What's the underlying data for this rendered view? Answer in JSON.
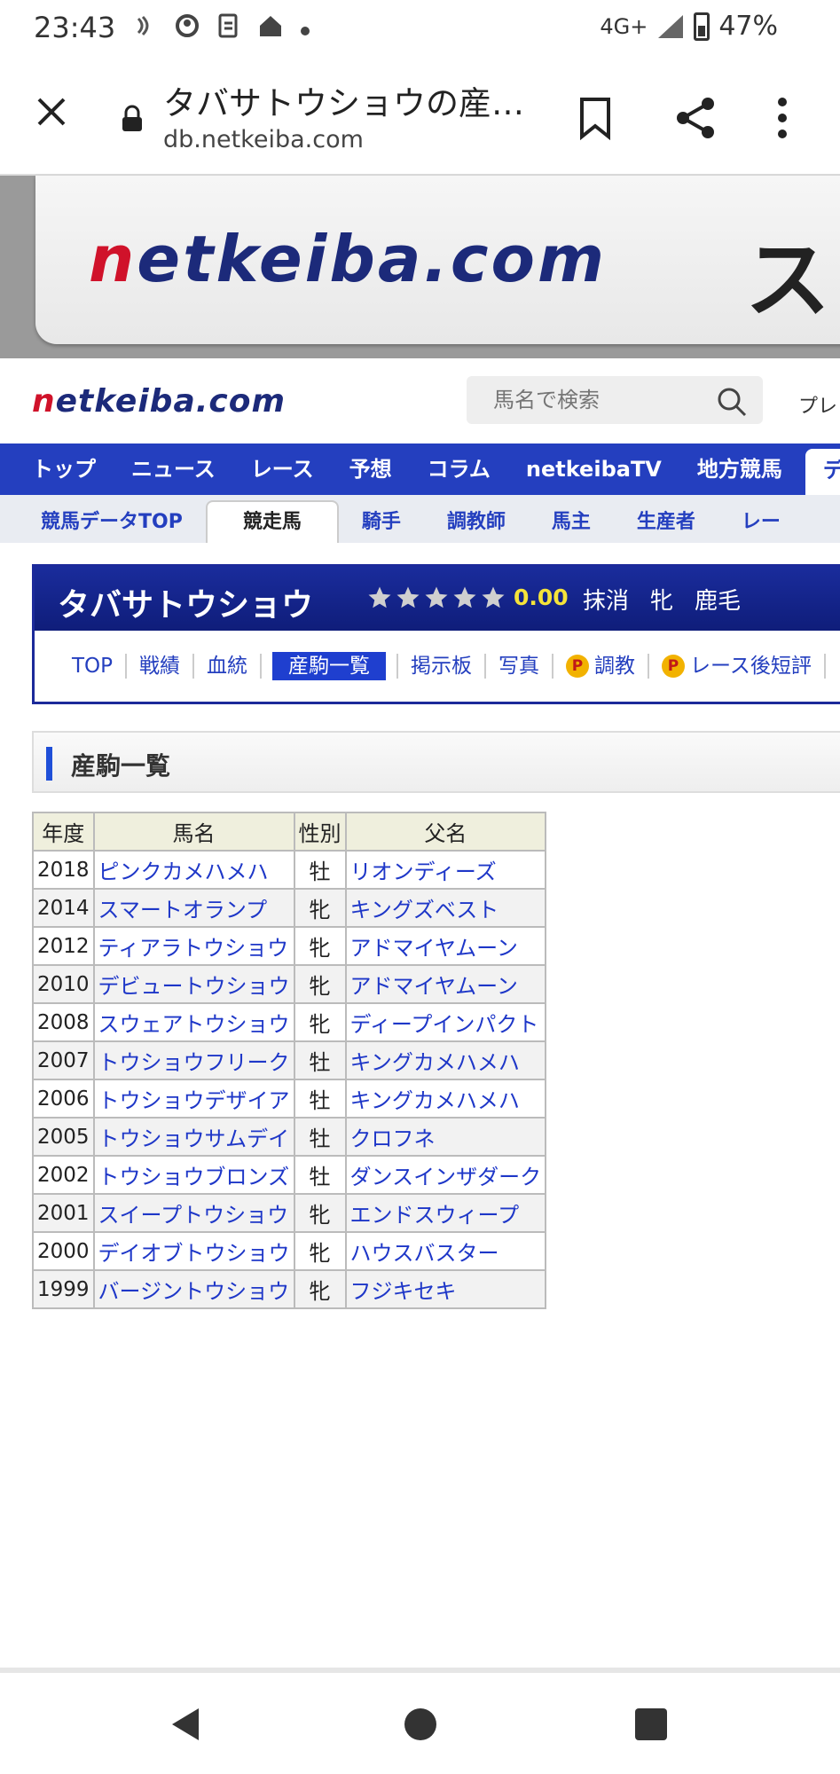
{
  "status_bar": {
    "time": "23:43",
    "network": "4G+",
    "battery": "47%",
    "icons": [
      "nfc-icon",
      "account-sync-icon",
      "file-transfer-icon",
      "home-icon",
      "dot-icon",
      "signal-icon",
      "battery-icon"
    ]
  },
  "browser": {
    "title": "タバサトウショウの産…",
    "url": "db.netkeiba.com",
    "icons": [
      "close-icon",
      "lock-icon",
      "bookmark-icon",
      "share-icon",
      "more-vert-icon"
    ]
  },
  "banner": {
    "logo_text": "netkeiba.com",
    "extra_text": "ス"
  },
  "header": {
    "logo_text": "netkeiba.com",
    "search_placeholder": "馬名で検索",
    "premium_label": "プレ"
  },
  "main_nav": [
    "トップ",
    "ニュース",
    "レース",
    "予想",
    "コラム",
    "netkeibaTV",
    "地方競馬",
    "デー"
  ],
  "sub_nav": [
    "競馬データTOP",
    "競走馬",
    "騎手",
    "調教師",
    "馬主",
    "生産者",
    "レー"
  ],
  "horse": {
    "name": "タバサトウショウ",
    "stars": 5,
    "rating": "0.00",
    "status": "抹消",
    "sex": "牝",
    "color": "鹿毛",
    "tabs": [
      "TOP",
      "戦績",
      "血統",
      "産駒一覧",
      "掲示板",
      "写真",
      "調教",
      "レース後短評"
    ],
    "badge_label": "P"
  },
  "section": {
    "title": "産駒一覧"
  },
  "table": {
    "headers": [
      "年度",
      "馬名",
      "性別",
      "父名"
    ],
    "rows": [
      [
        "2018",
        "ピンクカメハメハ",
        "牡",
        "リオンディーズ"
      ],
      [
        "2014",
        "スマートオランプ",
        "牝",
        "キングズベスト"
      ],
      [
        "2012",
        "ティアラトウショウ",
        "牝",
        "アドマイヤムーン"
      ],
      [
        "2010",
        "デビュートウショウ",
        "牝",
        "アドマイヤムーン"
      ],
      [
        "2008",
        "スウェアトウショウ",
        "牝",
        "ディープインパクト"
      ],
      [
        "2007",
        "トウショウフリーク",
        "牡",
        "キングカメハメハ"
      ],
      [
        "2006",
        "トウショウデザイア",
        "牡",
        "キングカメハメハ"
      ],
      [
        "2005",
        "トウショウサムデイ",
        "牡",
        "クロフネ"
      ],
      [
        "2002",
        "トウショウブロンズ",
        "牡",
        "ダンスインザダーク"
      ],
      [
        "2001",
        "スイープトウショウ",
        "牝",
        "エンドスウィープ"
      ],
      [
        "2000",
        "デイオブトウショウ",
        "牝",
        "ハウスバスター"
      ],
      [
        "1999",
        "バージントウショウ",
        "牝",
        "フジキセキ"
      ]
    ]
  },
  "colors": {
    "nav_blue": "#243fbf",
    "link_blue": "#1e37c8",
    "brand_red": "#d0122a",
    "star_yellow": "#f5e33a"
  }
}
